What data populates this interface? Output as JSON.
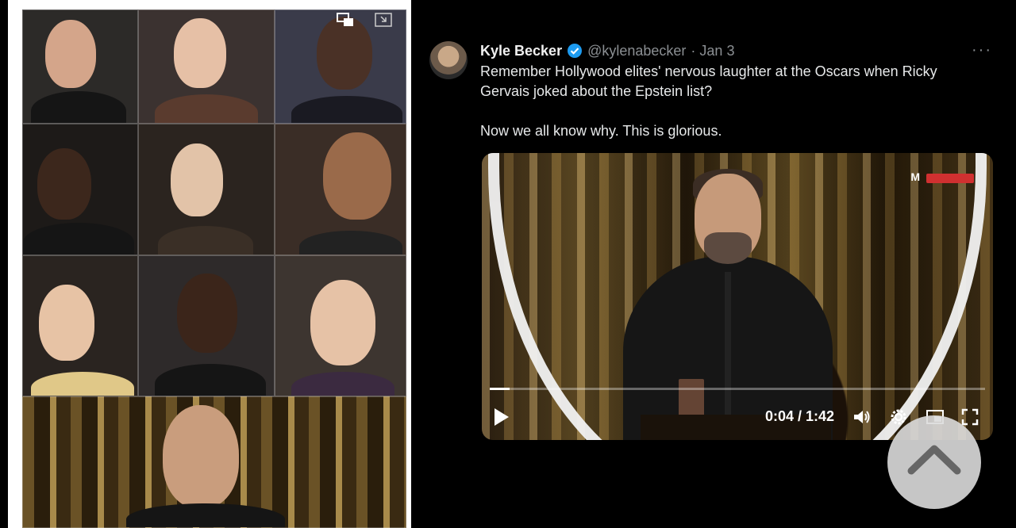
{
  "tweet": {
    "author_name": "Kyle Becker",
    "handle": "@kylenabecker",
    "date": "· Jan 3",
    "more": "···",
    "text": "Remember Hollywood elites' nervous laughter at the Oscars when Ricky Gervais joked about the Epstein list?\n\nNow we all know why. This is glorious.",
    "video": {
      "time": "0:04 / 1:42",
      "progress": 0.04,
      "watermark": "M"
    }
  },
  "colors": {
    "background": "#000000",
    "text": "#e7e9ea",
    "handle": "#8b8f93",
    "verified": "#1d9bf0"
  },
  "icons": [
    "verified-badge-icon",
    "more-options-icon",
    "play-icon",
    "volume-icon",
    "settings-gear-icon",
    "picture-in-picture-icon",
    "fullscreen-icon",
    "chevron-up-icon"
  ]
}
